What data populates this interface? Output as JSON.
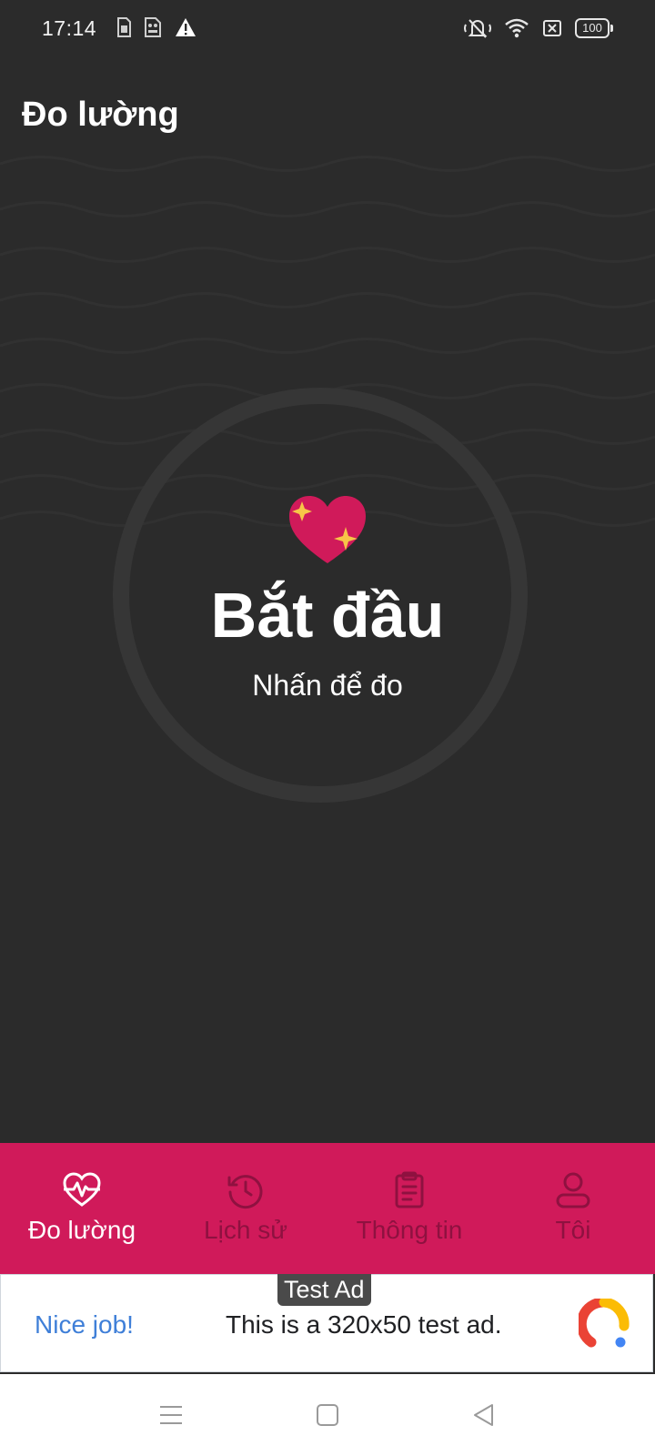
{
  "status": {
    "time": "17:14",
    "battery": "100",
    "left_icons": [
      "sim-card-icon",
      "sim-card-2-icon",
      "warning-icon"
    ],
    "right_icons": [
      "mute-icon",
      "wifi-icon",
      "x-box-icon",
      "battery-icon"
    ]
  },
  "header": {
    "title": "Đo lường"
  },
  "main": {
    "start_title": "Bắt đầu",
    "start_subtitle": "Nhấn để đo",
    "icon": "sparkling-heart-icon"
  },
  "nav": {
    "items": [
      {
        "label": "Đo lường",
        "icon": "heartbeat-icon",
        "active": true
      },
      {
        "label": "Lịch sử",
        "icon": "history-icon",
        "active": false
      },
      {
        "label": "Thông tin",
        "icon": "clipboard-icon",
        "active": false
      },
      {
        "label": "Tôi",
        "icon": "user-icon",
        "active": false
      }
    ]
  },
  "ad": {
    "badge": "Test Ad",
    "headline": "Nice job!",
    "body": "This is a 320x50 test ad."
  },
  "colors": {
    "background": "#2b2b2b",
    "accent": "#d01a5a",
    "inactive_nav": "#8f1140",
    "ad_link": "#3f7fd8"
  }
}
